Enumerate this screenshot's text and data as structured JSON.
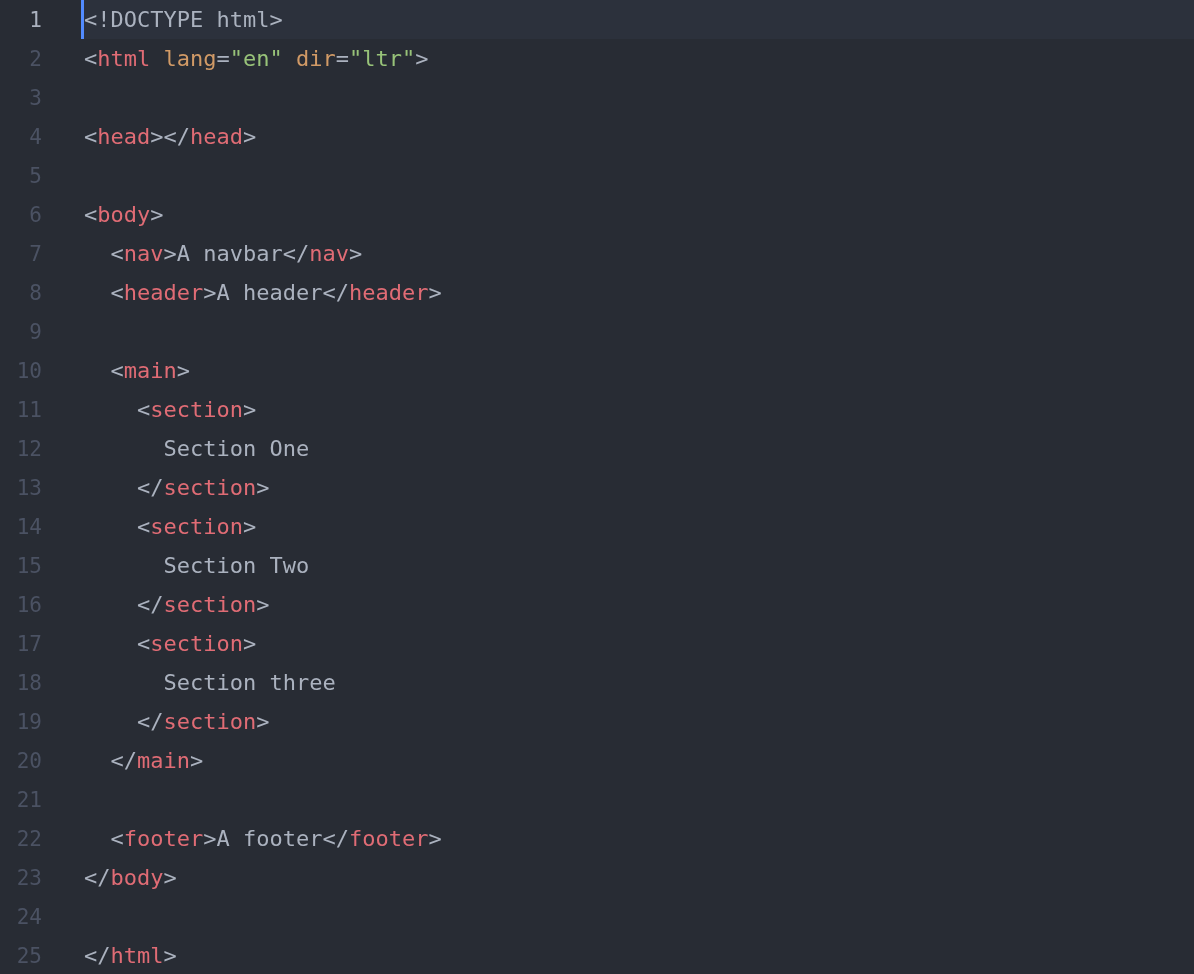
{
  "editor": {
    "lines": [
      {
        "number": "1",
        "active": true,
        "tokens": [
          {
            "kind": "punct",
            "text": "<!DOCTYPE html>"
          }
        ]
      },
      {
        "number": "2",
        "active": false,
        "tokens": [
          {
            "kind": "punct",
            "text": "<"
          },
          {
            "kind": "tag",
            "text": "html"
          },
          {
            "kind": "attr",
            "text": " lang"
          },
          {
            "kind": "punct",
            "text": "="
          },
          {
            "kind": "string",
            "text": "\"en\""
          },
          {
            "kind": "attr",
            "text": " dir"
          },
          {
            "kind": "punct",
            "text": "="
          },
          {
            "kind": "string",
            "text": "\"ltr\""
          },
          {
            "kind": "punct",
            "text": ">"
          }
        ]
      },
      {
        "number": "3",
        "active": false
      },
      {
        "number": "4",
        "active": false,
        "tokens": [
          {
            "kind": "punct",
            "text": "<"
          },
          {
            "kind": "tag",
            "text": "head"
          },
          {
            "kind": "punct",
            "text": "></"
          },
          {
            "kind": "tag",
            "text": "head"
          },
          {
            "kind": "punct",
            "text": ">"
          }
        ]
      },
      {
        "number": "5",
        "active": false
      },
      {
        "number": "6",
        "active": false,
        "tokens": [
          {
            "kind": "punct",
            "text": "<"
          },
          {
            "kind": "tag",
            "text": "body"
          },
          {
            "kind": "punct",
            "text": ">"
          }
        ]
      },
      {
        "number": "7",
        "active": false,
        "tokens": [
          {
            "kind": "punct",
            "text": "  <"
          },
          {
            "kind": "tag",
            "text": "nav"
          },
          {
            "kind": "punct",
            "text": ">A navbar</"
          },
          {
            "kind": "tag",
            "text": "nav"
          },
          {
            "kind": "punct",
            "text": ">"
          }
        ]
      },
      {
        "number": "8",
        "active": false,
        "tokens": [
          {
            "kind": "punct",
            "text": "  <"
          },
          {
            "kind": "tag",
            "text": "header"
          },
          {
            "kind": "punct",
            "text": ">A header</"
          },
          {
            "kind": "tag",
            "text": "header"
          },
          {
            "kind": "punct",
            "text": ">"
          }
        ]
      },
      {
        "number": "9",
        "active": false
      },
      {
        "number": "10",
        "active": false,
        "tokens": [
          {
            "kind": "punct",
            "text": "  <"
          },
          {
            "kind": "tag",
            "text": "main"
          },
          {
            "kind": "punct",
            "text": ">"
          }
        ]
      },
      {
        "number": "11",
        "active": false,
        "tokens": [
          {
            "kind": "punct",
            "text": "    <"
          },
          {
            "kind": "tag",
            "text": "section"
          },
          {
            "kind": "punct",
            "text": ">"
          }
        ]
      },
      {
        "number": "12",
        "active": false,
        "tokens": [
          {
            "kind": "punct",
            "text": "      Section One"
          }
        ]
      },
      {
        "number": "13",
        "active": false,
        "tokens": [
          {
            "kind": "punct",
            "text": "    </"
          },
          {
            "kind": "tag",
            "text": "section"
          },
          {
            "kind": "punct",
            "text": ">"
          }
        ]
      },
      {
        "number": "14",
        "active": false,
        "tokens": [
          {
            "kind": "punct",
            "text": "    <"
          },
          {
            "kind": "tag",
            "text": "section"
          },
          {
            "kind": "punct",
            "text": ">"
          }
        ]
      },
      {
        "number": "15",
        "active": false,
        "tokens": [
          {
            "kind": "punct",
            "text": "      Section Two"
          }
        ]
      },
      {
        "number": "16",
        "active": false,
        "tokens": [
          {
            "kind": "punct",
            "text": "    </"
          },
          {
            "kind": "tag",
            "text": "section"
          },
          {
            "kind": "punct",
            "text": ">"
          }
        ]
      },
      {
        "number": "17",
        "active": false,
        "tokens": [
          {
            "kind": "punct",
            "text": "    <"
          },
          {
            "kind": "tag",
            "text": "section"
          },
          {
            "kind": "punct",
            "text": ">"
          }
        ]
      },
      {
        "number": "18",
        "active": false,
        "tokens": [
          {
            "kind": "punct",
            "text": "      Section three"
          }
        ]
      },
      {
        "number": "19",
        "active": false,
        "tokens": [
          {
            "kind": "punct",
            "text": "    </"
          },
          {
            "kind": "tag",
            "text": "section"
          },
          {
            "kind": "punct",
            "text": ">"
          }
        ]
      },
      {
        "number": "20",
        "active": false,
        "tokens": [
          {
            "kind": "punct",
            "text": "  </"
          },
          {
            "kind": "tag",
            "text": "main"
          },
          {
            "kind": "punct",
            "text": ">"
          }
        ]
      },
      {
        "number": "21",
        "active": false
      },
      {
        "number": "22",
        "active": false,
        "tokens": [
          {
            "kind": "punct",
            "text": "  <"
          },
          {
            "kind": "tag",
            "text": "footer"
          },
          {
            "kind": "punct",
            "text": ">A footer</"
          },
          {
            "kind": "tag",
            "text": "footer"
          },
          {
            "kind": "punct",
            "text": ">"
          }
        ]
      },
      {
        "number": "23",
        "active": false,
        "tokens": [
          {
            "kind": "punct",
            "text": "</"
          },
          {
            "kind": "tag",
            "text": "body"
          },
          {
            "kind": "punct",
            "text": ">"
          }
        ]
      },
      {
        "number": "24",
        "active": false
      },
      {
        "number": "25",
        "active": false,
        "tokens": [
          {
            "kind": "punct",
            "text": "</"
          },
          {
            "kind": "tag",
            "text": "html"
          },
          {
            "kind": "punct",
            "text": ">"
          }
        ]
      }
    ]
  }
}
